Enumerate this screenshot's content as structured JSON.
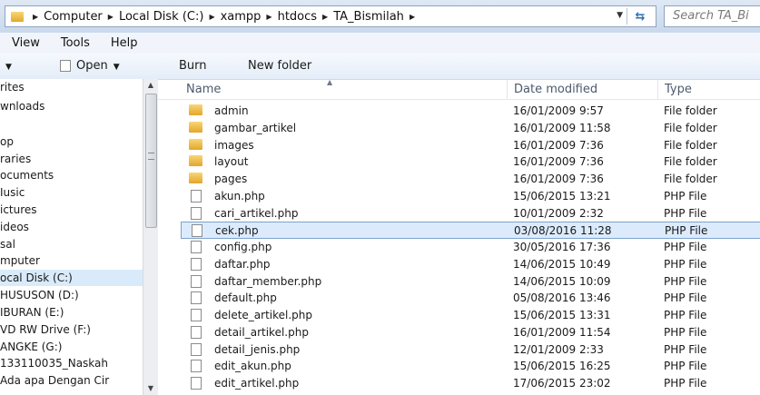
{
  "address": {
    "crumbs": [
      "Computer",
      "Local Disk (C:)",
      "xampp",
      "htdocs",
      "TA_Bismilah"
    ],
    "search_placeholder": "Search TA_Bi"
  },
  "menu": [
    "View",
    "Tools",
    "Help"
  ],
  "toolbar": {
    "open_label": "Open",
    "burn_label": "Burn",
    "new_folder_label": "New folder"
  },
  "nav": {
    "items": [
      "rites",
      "wnloads",
      "",
      "op",
      "raries",
      "ocuments",
      "Iusic",
      "ictures",
      "ideos",
      "sal",
      "mputer",
      "ocal Disk (C:)",
      "HUSUSON (D:)",
      "IBURAN (E:)",
      "VD RW Drive (F:)",
      "ANGKE (G:)",
      "133110035_Naskah",
      "Ada apa Dengan Cir"
    ],
    "selected_index": 11
  },
  "columns": {
    "name": "Name",
    "date": "Date modified",
    "type": "Type"
  },
  "files": [
    {
      "name": "admin",
      "date": "16/01/2009 9:57",
      "type": "File folder",
      "kind": "folder"
    },
    {
      "name": "gambar_artikel",
      "date": "16/01/2009 11:58",
      "type": "File folder",
      "kind": "folder"
    },
    {
      "name": "images",
      "date": "16/01/2009 7:36",
      "type": "File folder",
      "kind": "folder"
    },
    {
      "name": "layout",
      "date": "16/01/2009 7:36",
      "type": "File folder",
      "kind": "folder"
    },
    {
      "name": "pages",
      "date": "16/01/2009 7:36",
      "type": "File folder",
      "kind": "folder"
    },
    {
      "name": "akun.php",
      "date": "15/06/2015 13:21",
      "type": "PHP File",
      "kind": "file"
    },
    {
      "name": "cari_artikel.php",
      "date": "10/01/2009 2:32",
      "type": "PHP File",
      "kind": "file"
    },
    {
      "name": "cek.php",
      "date": "03/08/2016 11:28",
      "type": "PHP File",
      "kind": "file"
    },
    {
      "name": "config.php",
      "date": "30/05/2016 17:36",
      "type": "PHP File",
      "kind": "file"
    },
    {
      "name": "daftar.php",
      "date": "14/06/2015 10:49",
      "type": "PHP File",
      "kind": "file"
    },
    {
      "name": "daftar_member.php",
      "date": "14/06/2015 10:09",
      "type": "PHP File",
      "kind": "file"
    },
    {
      "name": "default.php",
      "date": "05/08/2016 13:46",
      "type": "PHP File",
      "kind": "file"
    },
    {
      "name": "delete_artikel.php",
      "date": "15/06/2015 13:31",
      "type": "PHP File",
      "kind": "file"
    },
    {
      "name": "detail_artikel.php",
      "date": "16/01/2009 11:54",
      "type": "PHP File",
      "kind": "file"
    },
    {
      "name": "detail_jenis.php",
      "date": "12/01/2009 2:33",
      "type": "PHP File",
      "kind": "file"
    },
    {
      "name": "edit_akun.php",
      "date": "15/06/2015 16:25",
      "type": "PHP File",
      "kind": "file"
    },
    {
      "name": "edit_artikel.php",
      "date": "17/06/2015 23:02",
      "type": "PHP File",
      "kind": "file"
    }
  ],
  "selected_file_index": 7
}
